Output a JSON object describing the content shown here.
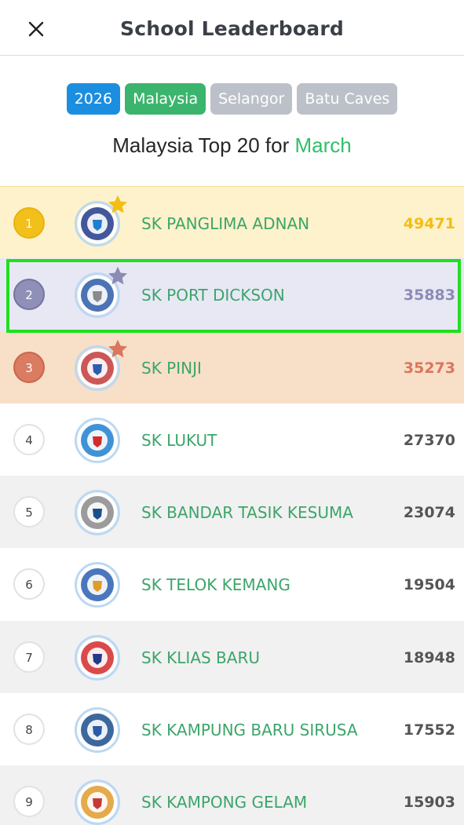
{
  "header": {
    "title": "School Leaderboard",
    "close_icon": "close-icon"
  },
  "filters": [
    {
      "label": "2026",
      "color": "#1c8ee0"
    },
    {
      "label": "Malaysia",
      "color": "#3bb56d"
    },
    {
      "label": "Selangor",
      "color": "#bcc1c9"
    },
    {
      "label": "Batu Caves",
      "color": "#bcc1c9"
    }
  ],
  "subtitle": {
    "prefix": "Malaysia Top 20 for",
    "month": "March",
    "month_color": "#2fbf6a"
  },
  "colors": {
    "gold_bg": "#fdf2cc",
    "gold": "#f3bd12",
    "silver_bg": "#e8e8f5",
    "silver": "#8b8bb5",
    "bronze_bg": "#f8dfc8",
    "bronze": "#d9775c",
    "name_green": "#3ca56a",
    "score_dark": "#555555",
    "stripe": "#f1f1f1",
    "highlight": "#1ee01e"
  },
  "leaderboard": [
    {
      "rank": "1",
      "name": "SK PANGLIMA ADNAN",
      "score": "49471",
      "tier": "gold",
      "logo": "school-crest-icon"
    },
    {
      "rank": "2",
      "name": "SK PORT DICKSON",
      "score": "35883",
      "tier": "silver",
      "logo": "school-crest-icon"
    },
    {
      "rank": "3",
      "name": "SK PINJI",
      "score": "35273",
      "tier": "bronze",
      "logo": "school-crest-icon"
    },
    {
      "rank": "4",
      "name": "SK LUKUT",
      "score": "27370",
      "tier": "none",
      "logo": "school-crest-icon"
    },
    {
      "rank": "5",
      "name": "SK BANDAR TASIK KESUMA",
      "score": "23074",
      "tier": "none",
      "logo": "school-crest-icon"
    },
    {
      "rank": "6",
      "name": "SK TELOK KEMANG",
      "score": "19504",
      "tier": "none",
      "logo": "school-crest-icon"
    },
    {
      "rank": "7",
      "name": "SK KLIAS BARU",
      "score": "18948",
      "tier": "none",
      "logo": "school-crest-icon"
    },
    {
      "rank": "8",
      "name": "SK KAMPUNG BARU SIRUSA",
      "score": "17552",
      "tier": "none",
      "logo": "school-crest-icon"
    },
    {
      "rank": "9",
      "name": "SK KAMPONG GELAM",
      "score": "15903",
      "tier": "none",
      "logo": "school-crest-icon"
    }
  ]
}
